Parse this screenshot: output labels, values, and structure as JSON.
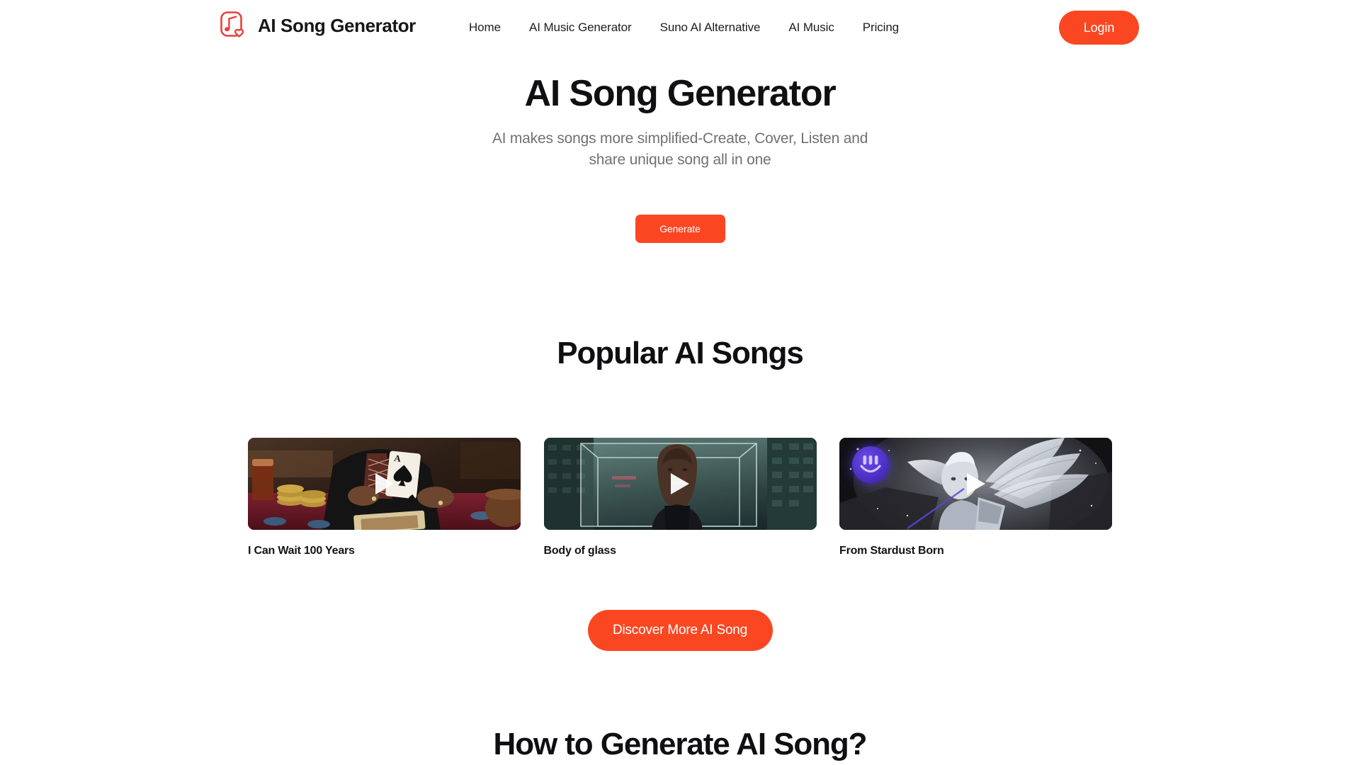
{
  "header": {
    "brand_name": "AI Song Generator",
    "logo_icon": "music-note-heart-icon",
    "nav": [
      {
        "label": "Home"
      },
      {
        "label": "AI Music Generator"
      },
      {
        "label": "Suno AI Alternative"
      },
      {
        "label": "AI Music"
      },
      {
        "label": "Pricing"
      }
    ],
    "login_label": "Login"
  },
  "hero": {
    "title": "AI Song Generator",
    "subtitle": "AI makes songs more simplified-Create, Cover, Listen and share unique song all in one",
    "generate_label": "Generate"
  },
  "popular": {
    "section_title": "Popular AI Songs",
    "songs": [
      {
        "title": "I Can Wait 100 Years",
        "play_icon": "play-icon",
        "badge": ""
      },
      {
        "title": "Body of glass",
        "play_icon": "play-icon",
        "badge": ""
      },
      {
        "title": "From Stardust Born",
        "play_icon": "play-icon",
        "badge": "purple-smile-watermark"
      }
    ],
    "discover_label": "Discover More AI Song"
  },
  "howto": {
    "title": "How to Generate AI Song?"
  },
  "colors": {
    "accent": "#fa4722",
    "text_primary": "#111111",
    "text_muted": "#6f7174",
    "badge_purple": "#5b3fd6",
    "page_background": "#ffffff"
  }
}
